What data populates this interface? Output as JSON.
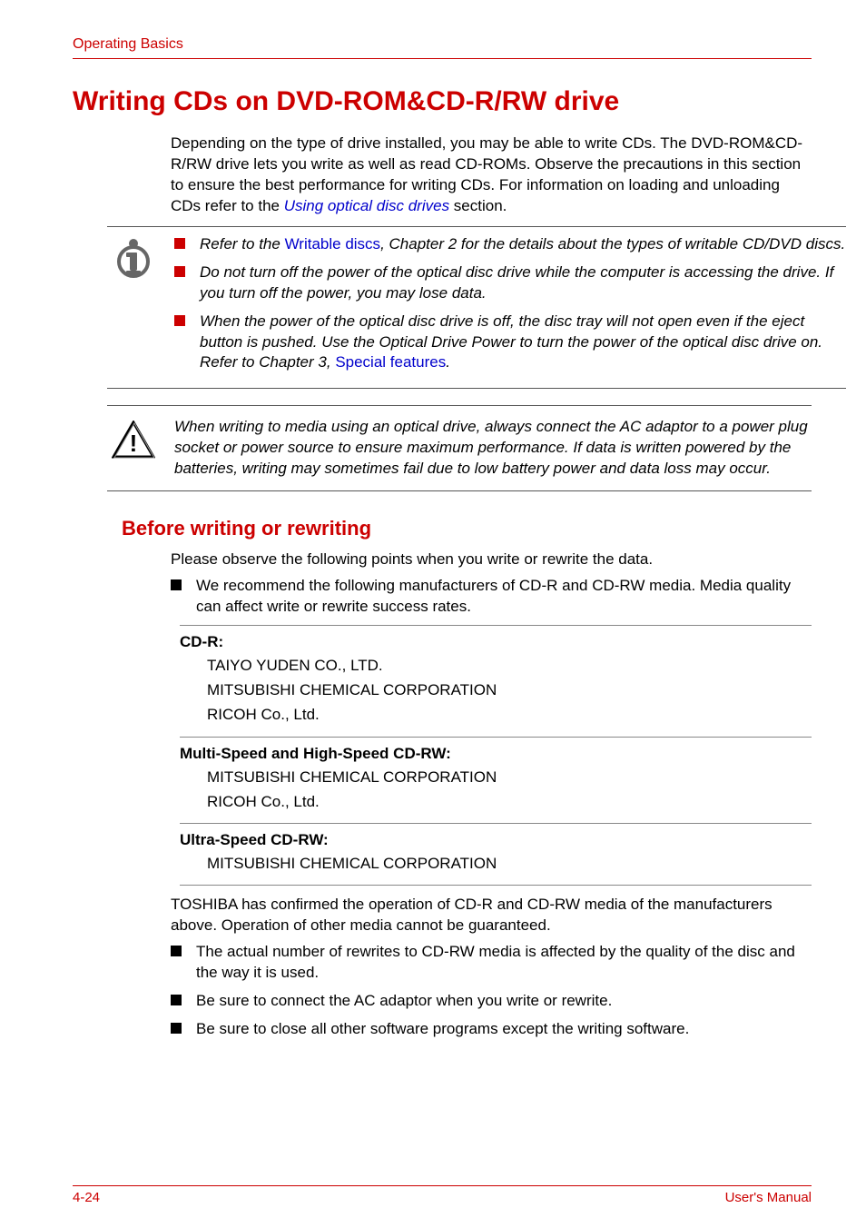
{
  "header": "Operating Basics",
  "h1": "Writing CDs on DVD-ROM&CD-R/RW drive",
  "intro_part1": "Depending on the type of drive installed, you may be able to write CDs. The DVD-ROM&CD-R/RW drive lets you write as well as read CD-ROMs. Observe the precautions in this section to ensure the best performance for writing CDs. For information on loading and unloading CDs refer to the ",
  "intro_link": "Using optical disc drives",
  "intro_part2": " section.",
  "note": {
    "item1_pre": "Refer to the ",
    "item1_link": "Writable discs",
    "item1_post": ", Chapter 2 for the details about the types of writable CD/DVD discs.",
    "item2": "Do not turn off the power of the optical disc drive while the computer is accessing the drive. If you turn off the power, you may lose data.",
    "item3_pre": "When the power of the optical disc drive is off, the disc tray will not open even if the eject button is pushed. Use the Optical Drive Power to turn the power of the optical disc drive on. Refer to Chapter 3, ",
    "item3_link": "Special features",
    "item3_post": "."
  },
  "caution": "When writing to media using an optical drive, always connect the AC adaptor to a power plug socket or power source to ensure maximum performance. If data is written powered by the batteries, writing may sometimes fail due to low battery power and data loss may occur.",
  "h2": "Before writing or rewriting",
  "h2_intro": "Please observe the following points when you write or rewrite the data.",
  "bullet_rec": "We recommend the following manufacturers of CD-R and CD-RW media. Media quality can affect write or rewrite success rates.",
  "media": [
    {
      "head": "CD-R:",
      "items": [
        "TAIYO YUDEN CO., LTD.",
        "MITSUBISHI CHEMICAL CORPORATION",
        "RICOH Co., Ltd."
      ]
    },
    {
      "head": "Multi-Speed and High-Speed CD-RW:",
      "items": [
        "MITSUBISHI CHEMICAL CORPORATION",
        "RICOH Co., Ltd."
      ]
    },
    {
      "head": "Ultra-Speed CD-RW:",
      "items": [
        "MITSUBISHI CHEMICAL CORPORATION"
      ]
    }
  ],
  "confirm": "TOSHIBA has confirmed the operation of CD-R and CD-RW media of the manufacturers above. Operation of other media cannot be guaranteed.",
  "tail_bullets": [
    "The actual number of rewrites to CD-RW media is affected by the quality of the disc and the way it is used.",
    "Be sure to connect the AC adaptor when you write or rewrite.",
    "Be sure to close all other software programs except the writing software."
  ],
  "footer_left": "4-24",
  "footer_right": "User's Manual"
}
